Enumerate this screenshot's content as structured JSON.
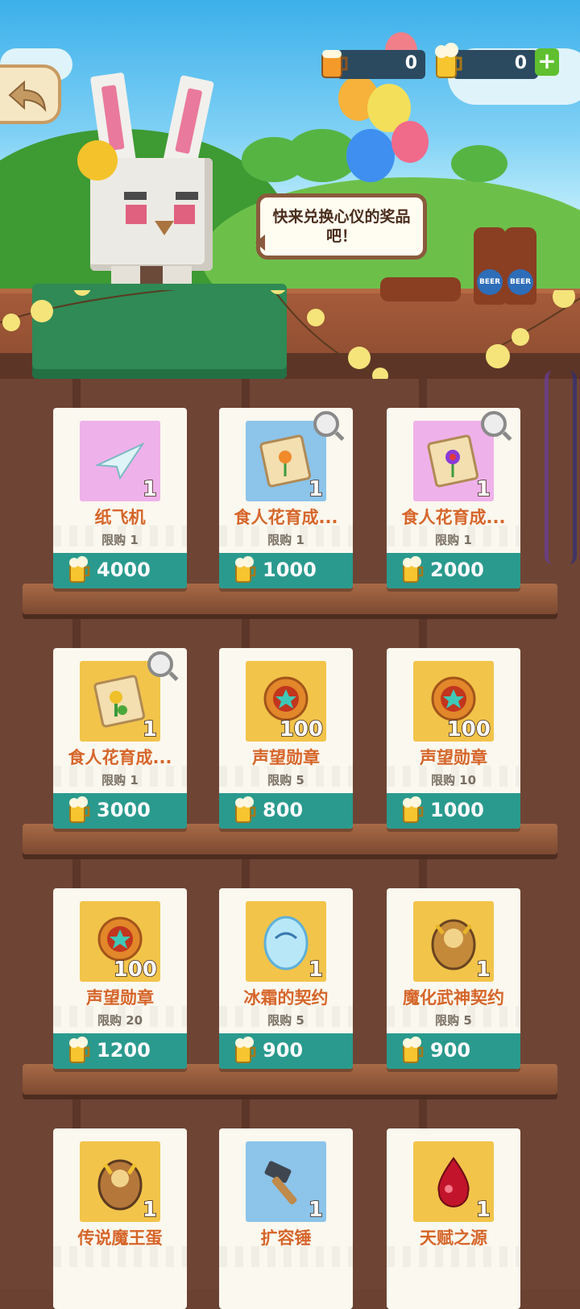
{
  "currency": [
    {
      "icon": "beer-mug-icon",
      "value": "0"
    },
    {
      "icon": "golden-beer-icon",
      "value": "0"
    }
  ],
  "bubble_text": "快来兑换心仪的奖品吧！",
  "bottle_label": "BEER",
  "items": [
    {
      "name": "纸飞机",
      "qty": "1",
      "limit": "限购 1",
      "price": "4000",
      "bg": "pink",
      "icon": "paper-plane-icon",
      "mag": false
    },
    {
      "name": "食人花育成...",
      "qty": "1",
      "limit": "限购 1",
      "price": "1000",
      "bg": "blue",
      "icon": "flower-blueprint-icon",
      "mag": true
    },
    {
      "name": "食人花育成...",
      "qty": "1",
      "limit": "限购 1",
      "price": "2000",
      "bg": "pink",
      "icon": "purple-flower-blueprint-icon",
      "mag": true
    },
    {
      "name": "食人花育成...",
      "qty": "1",
      "limit": "限购 1",
      "price": "3000",
      "bg": "gold",
      "icon": "green-flower-blueprint-icon",
      "mag": true
    },
    {
      "name": "声望勋章",
      "qty": "100",
      "limit": "限购 5",
      "price": "800",
      "bg": "gold",
      "icon": "prestige-medal-icon",
      "mag": false
    },
    {
      "name": "声望勋章",
      "qty": "100",
      "limit": "限购 10",
      "price": "1000",
      "bg": "gold",
      "icon": "prestige-medal-icon",
      "mag": false
    },
    {
      "name": "声望勋章",
      "qty": "100",
      "limit": "限购 20",
      "price": "1200",
      "bg": "gold",
      "icon": "prestige-medal-icon",
      "mag": false
    },
    {
      "name": "冰霜的契约",
      "qty": "1",
      "limit": "限购 5",
      "price": "900",
      "bg": "gold",
      "icon": "frost-contract-egg-icon",
      "mag": false
    },
    {
      "name": "魔化武神契约",
      "qty": "1",
      "limit": "限购 5",
      "price": "900",
      "bg": "gold",
      "icon": "demon-war-god-egg-icon",
      "mag": false
    },
    {
      "name": "传说魔王蛋",
      "qty": "1",
      "limit": "",
      "price": "",
      "bg": "gold",
      "icon": "legend-demon-egg-icon",
      "mag": false
    },
    {
      "name": "扩容锤",
      "qty": "1",
      "limit": "",
      "price": "",
      "bg": "blue",
      "icon": "hammer-icon",
      "mag": false
    },
    {
      "name": "天赋之源",
      "qty": "1",
      "limit": "",
      "price": "",
      "bg": "gold",
      "icon": "talent-drop-icon",
      "mag": false
    }
  ]
}
